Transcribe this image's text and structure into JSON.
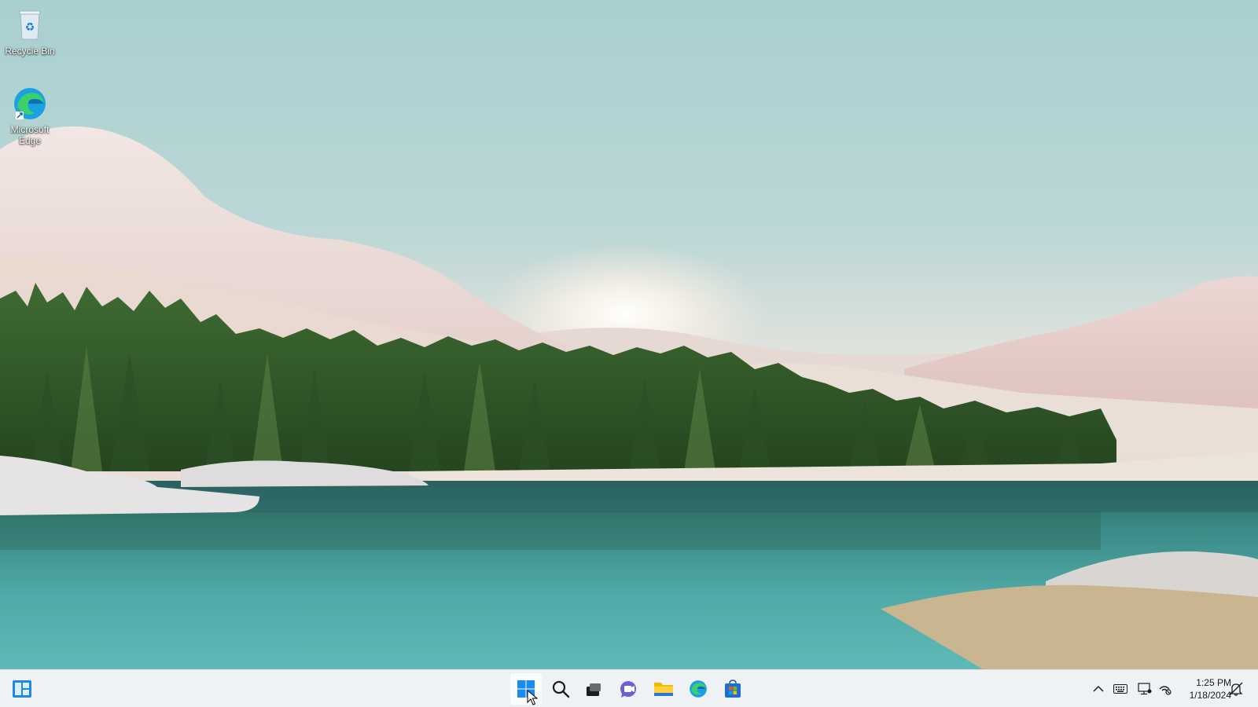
{
  "desktop": {
    "icons": [
      {
        "label": "Recycle Bin",
        "icon": "recycle-bin-icon"
      },
      {
        "label": "Microsoft Edge",
        "icon": "edge-icon"
      }
    ]
  },
  "taskbar": {
    "left_widget": "widgets-icon",
    "pinned": [
      {
        "name": "Start",
        "icon": "windows-start-icon",
        "active": true
      },
      {
        "name": "Search",
        "icon": "search-icon"
      },
      {
        "name": "Task View",
        "icon": "task-view-icon"
      },
      {
        "name": "Chat",
        "icon": "teams-chat-icon"
      },
      {
        "name": "File Explorer",
        "icon": "folder-icon"
      },
      {
        "name": "Microsoft Edge",
        "icon": "edge-icon"
      },
      {
        "name": "Microsoft Store",
        "icon": "store-icon"
      }
    ],
    "tray": {
      "icons": [
        "chevron-up-icon",
        "keyboard-icon",
        "display-icon",
        "network-icon",
        "notification-bell-icon"
      ],
      "time": "1:25 PM",
      "date": "1/18/2024"
    }
  },
  "colors": {
    "taskbar_bg": "#eef2f4",
    "accent": "#0a74d9"
  }
}
